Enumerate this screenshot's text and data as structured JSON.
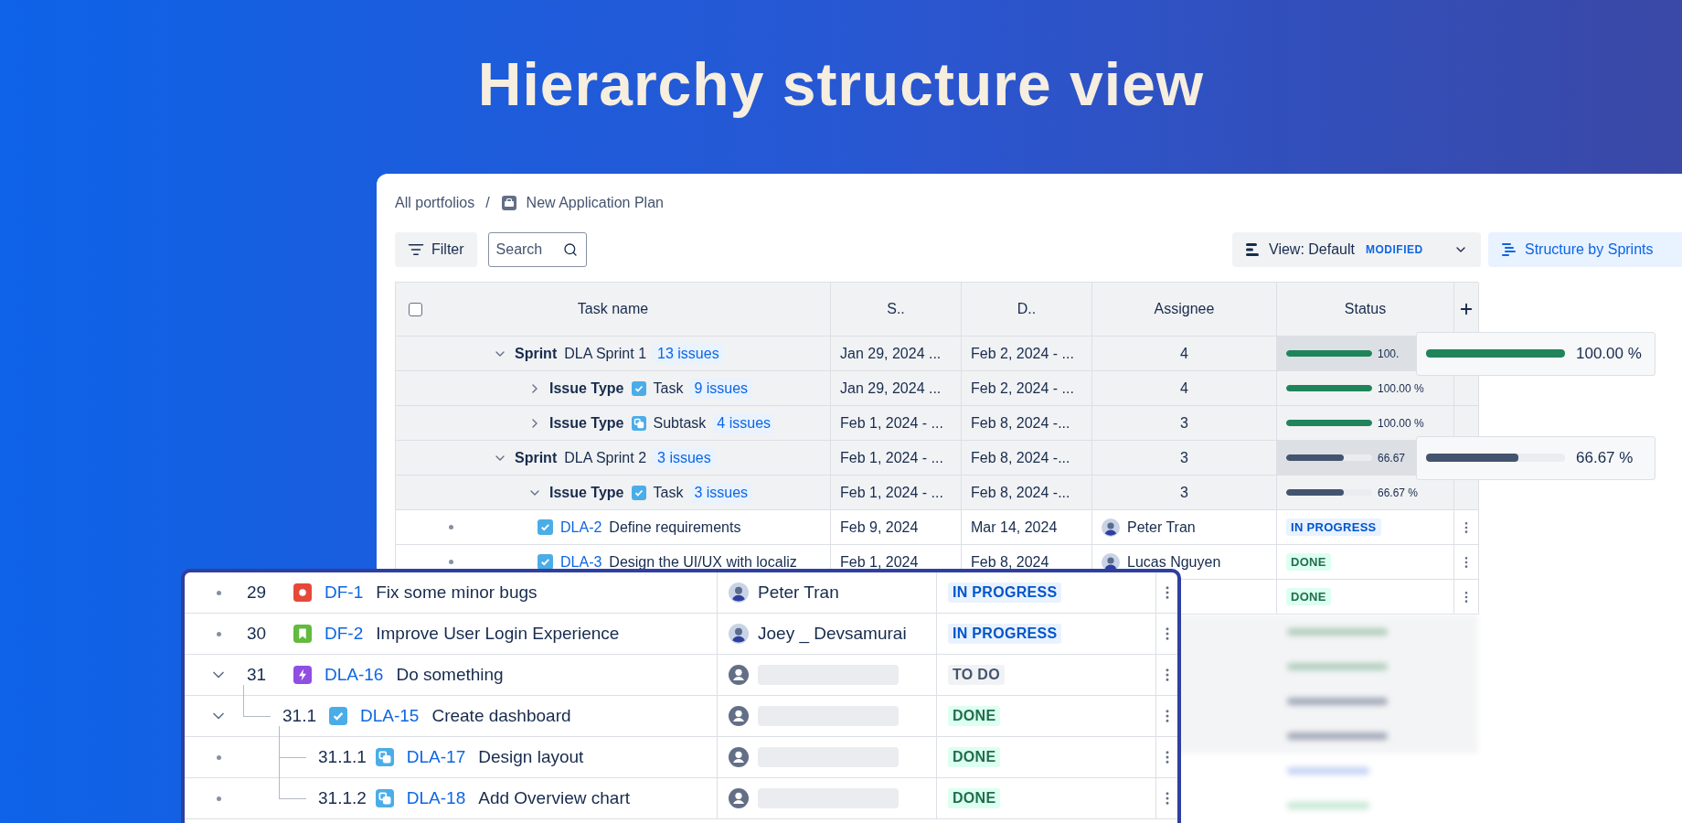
{
  "headline": "Hierarchy structure view",
  "breadcrumb": {
    "root": "All portfolios",
    "separator": "/",
    "current": "New Application Plan"
  },
  "toolbar": {
    "filter": "Filter",
    "search": {
      "placeholder": "Search"
    },
    "view": {
      "label": "View: Default",
      "badge": "MODIFIED"
    },
    "structure": "Structure by Sprints"
  },
  "table": {
    "select_all": {
      "checked": false
    },
    "columns": [
      {
        "kind": "task",
        "label": "Task name"
      },
      {
        "kind": "start",
        "label": "S.."
      },
      {
        "kind": "due",
        "label": "D.."
      },
      {
        "kind": "assignee",
        "label": "Assignee"
      },
      {
        "kind": "status",
        "label": "Status"
      },
      {
        "kind": "add"
      }
    ],
    "rows": [
      {
        "kind": "sprint",
        "label": "Sprint",
        "name": "DLA Sprint 1",
        "count": "13 issues",
        "start": "Jan 29, 2024 ...",
        "due": "Feb 2, 2024 - ...",
        "assignees": "4",
        "level": 1,
        "reading": "100.",
        "tooltip": {
          "level": 1,
          "reading": "100.00 %"
        },
        "expanded": true,
        "children": [
          {
            "kind": "group",
            "label": "Issue Type",
            "icon": {
              "kind": "task"
            },
            "name": "Task",
            "count": "9 issues",
            "start": "Jan 29, 2024 ...",
            "due": "Feb 2, 2024 - ...",
            "assignees": "4",
            "level": 1,
            "reading": "100.00 %",
            "expanded": false
          },
          {
            "kind": "group",
            "label": "Issue Type",
            "icon": {
              "kind": "subtask"
            },
            "name": "Subtask",
            "count": "4 issues",
            "start": "Feb 1, 2024 - ...",
            "due": "Feb 8, 2024 -...",
            "assignees": "3",
            "level": 1,
            "reading": "100.00 %",
            "expanded": false
          }
        ]
      },
      {
        "kind": "sprint",
        "label": "Sprint",
        "name": "DLA Sprint 2",
        "count": "3 issues",
        "start": "Feb 1, 2024 - ...",
        "due": "Feb 8, 2024 -...",
        "assignees": "3",
        "level": 0.6667,
        "reading": "66.67",
        "tooltip": {
          "level": 0.6667,
          "reading": "66.67 %"
        },
        "expanded": true,
        "children": [
          {
            "kind": "group",
            "label": "Issue Type",
            "icon": {
              "kind": "task"
            },
            "name": "Task",
            "count": "3 issues",
            "start": "Feb 1, 2024 - ...",
            "due": "Feb 8, 2024 -...",
            "assignees": "3",
            "level": 0.6667,
            "reading": "66.67 %",
            "expanded": true,
            "children": [
              {
                "kind": "issue",
                "icon": {
                  "kind": "task"
                },
                "key": "DLA-2",
                "summary": "Define requirements",
                "start": "Feb 9, 2024",
                "due": "Mar 14, 2024",
                "assignee": {
                  "kind": "person",
                  "name": "Peter Tran"
                },
                "status": {
                  "kind": "inprogress",
                  "label": "IN PROGRESS"
                }
              },
              {
                "kind": "issue",
                "icon": {
                  "kind": "task"
                },
                "key": "DLA-3",
                "summary": "Design the UI/UX with localiz",
                "start": "Feb 1, 2024",
                "due": "Feb 8, 2024",
                "assignee": {
                  "kind": "person",
                  "name": "Lucas Nguyen"
                },
                "status": {
                  "kind": "done",
                  "label": "DONE"
                }
              },
              {
                "kind": "issue",
                "status": {
                  "kind": "done",
                  "label": "DONE"
                }
              }
            ]
          }
        ]
      }
    ]
  },
  "overlay": {
    "rows": [
      {
        "number": "29",
        "icon": {
          "kind": "bug"
        },
        "key": "DF-1",
        "summary": "Fix some minor bugs",
        "assignee": {
          "kind": "person",
          "name": "Peter Tran"
        },
        "status": {
          "kind": "inprogress",
          "label": "IN PROGRESS"
        }
      },
      {
        "number": "30",
        "icon": {
          "kind": "story"
        },
        "key": "DF-2",
        "summary": "Improve User Login Experience",
        "assignee": {
          "kind": "person",
          "name": "Joey _ Devsamurai"
        },
        "status": {
          "kind": "inprogress",
          "label": "IN PROGRESS"
        }
      },
      {
        "number": "31",
        "icon": {
          "kind": "epic"
        },
        "key": "DLA-16",
        "summary": "Do something",
        "assignee": {
          "kind": "unassigned"
        },
        "status": {
          "kind": "todo",
          "label": "TO DO"
        },
        "expanded": true,
        "children": [
          {
            "number": "31.1",
            "icon": {
              "kind": "task"
            },
            "key": "DLA-15",
            "summary": "Create dashboard",
            "assignee": {
              "kind": "unassigned"
            },
            "status": {
              "kind": "done",
              "label": "DONE"
            },
            "expanded": true,
            "children": [
              {
                "number": "31.1.1",
                "icon": {
                  "kind": "subtask"
                },
                "key": "DLA-17",
                "summary": "Design layout",
                "assignee": {
                  "kind": "unassigned"
                },
                "status": {
                  "kind": "done",
                  "label": "DONE"
                }
              },
              {
                "number": "31.1.2",
                "icon": {
                  "kind": "subtask"
                },
                "key": "DLA-18",
                "summary": "Add Overview chart",
                "assignee": {
                  "kind": "unassigned"
                },
                "status": {
                  "kind": "done",
                  "label": "DONE"
                }
              }
            ]
          }
        ]
      }
    ]
  }
}
